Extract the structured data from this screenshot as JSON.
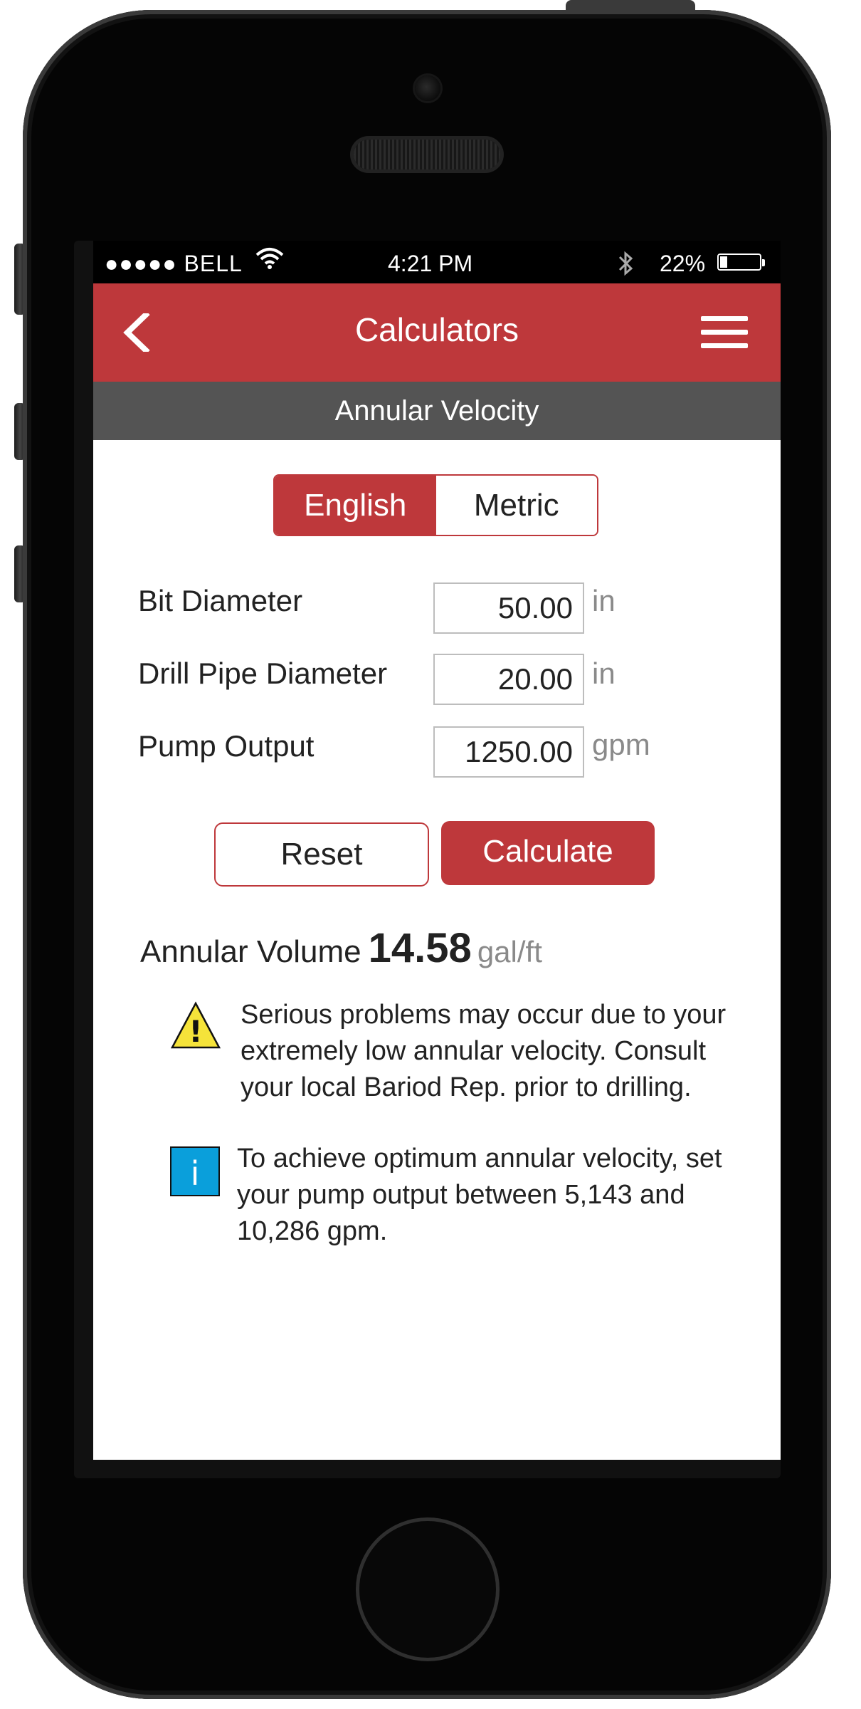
{
  "status_bar": {
    "carrier": "●●●●● BELL",
    "time": "4:21 PM",
    "battery": "22%"
  },
  "nav": {
    "title": "Calculators"
  },
  "section": {
    "title": "Annular Velocity"
  },
  "units_toggle": {
    "english": "English",
    "metric": "Metric",
    "selected": "English"
  },
  "fields": [
    {
      "label": "Bit Diameter",
      "value": "50.00",
      "unit": "in"
    },
    {
      "label": "Drill Pipe Diameter",
      "value": "20.00",
      "unit": "in"
    },
    {
      "label": "Pump Output",
      "value": "1250.00",
      "unit": "gpm"
    }
  ],
  "actions": {
    "reset": "Reset",
    "calculate": "Calculate"
  },
  "result": {
    "label": "Annular Volume",
    "value": "14.58",
    "unit": "gal/ft"
  },
  "messages": {
    "warning": {
      "icon_text": "!",
      "line1": "Serious problems may occur due to your",
      "line2": "extremely low annular velocity. Consult",
      "line3": "your local Bariod Rep. prior to drilling."
    },
    "info": {
      "icon_text": "i",
      "line1": "To achieve optimum annular velocity, set",
      "line2": "your pump output between 5,143 and",
      "line3": "10,286 gpm."
    }
  },
  "colors": {
    "brand_red": "#be383b",
    "section_gray": "#545454",
    "warning_yellow": "#f5e33a",
    "info_blue": "#0a9fdb"
  }
}
